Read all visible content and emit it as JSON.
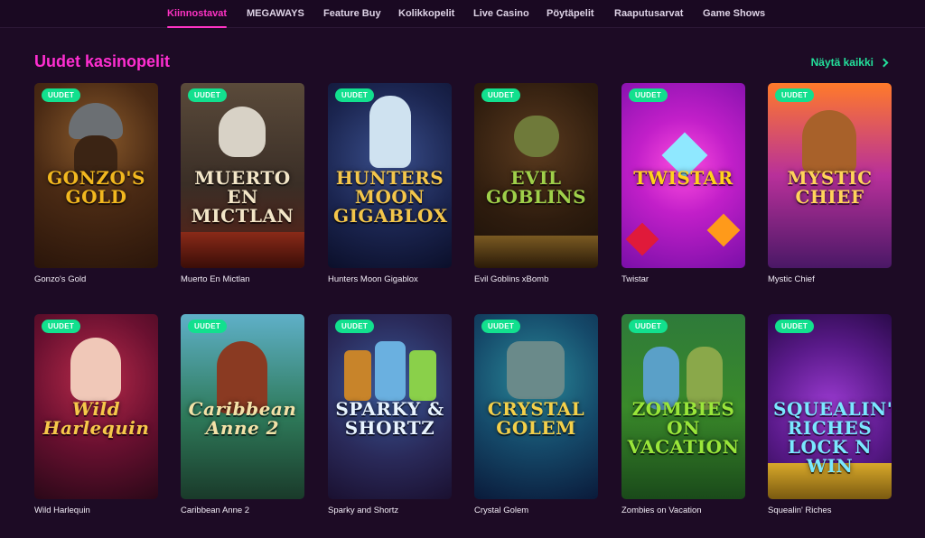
{
  "nav": {
    "tabs": [
      {
        "label": "Kiinnostavat",
        "active": true
      },
      {
        "label": "MEGAWAYS",
        "active": false
      },
      {
        "label": "Feature Buy",
        "active": false
      },
      {
        "label": "Kolikkopelit",
        "active": false
      },
      {
        "label": "Live Casino",
        "active": false
      },
      {
        "label": "Pöytäpelit",
        "active": false
      },
      {
        "label": "Raaputusarvat",
        "active": false
      },
      {
        "label": "Game Shows",
        "active": false
      }
    ]
  },
  "section": {
    "title": "Uudet kasinopelit",
    "show_all_label": "Näytä kaikki",
    "show_all_icon": "chevron-right-icon"
  },
  "colors": {
    "accent_pink": "#ff2ed1",
    "accent_green": "#23e09b",
    "badge_green": "#12e08e",
    "background": "#1d0b25"
  },
  "games": [
    {
      "name": "Gonzo's Gold",
      "badge": "UUDET",
      "logo": "GONZO'S GOLD"
    },
    {
      "name": "Muerto En Mictlan",
      "badge": "UUDET",
      "logo": "MUERTO EN MICTLAN"
    },
    {
      "name": "Hunters Moon Gigablox",
      "badge": "UUDET",
      "logo": "HUNTERS MOON GIGABLOX"
    },
    {
      "name": "Evil Goblins xBomb",
      "badge": "UUDET",
      "logo": "EVIL GOBLINS"
    },
    {
      "name": "Twistar",
      "badge": "UUDET",
      "logo": "TWISTAR"
    },
    {
      "name": "Mystic Chief",
      "badge": "UUDET",
      "logo": "MYSTIC CHIEF"
    },
    {
      "name": "Wild Harlequin",
      "badge": "UUDET",
      "logo": "Wild Harlequin"
    },
    {
      "name": "Caribbean Anne 2",
      "badge": "UUDET",
      "logo": "Caribbean Anne 2"
    },
    {
      "name": "Sparky and Shortz",
      "badge": "UUDET",
      "logo": "SPARKY & SHORTZ"
    },
    {
      "name": "Crystal Golem",
      "badge": "UUDET",
      "logo": "CRYSTAL GOLEM"
    },
    {
      "name": "Zombies on Vacation",
      "badge": "UUDET",
      "logo": "ZOMBIES ON VACATION"
    },
    {
      "name": "Squealin' Riches",
      "badge": "UUDET",
      "logo": "SQUEALIN' RICHES LOCK N WIN"
    }
  ]
}
